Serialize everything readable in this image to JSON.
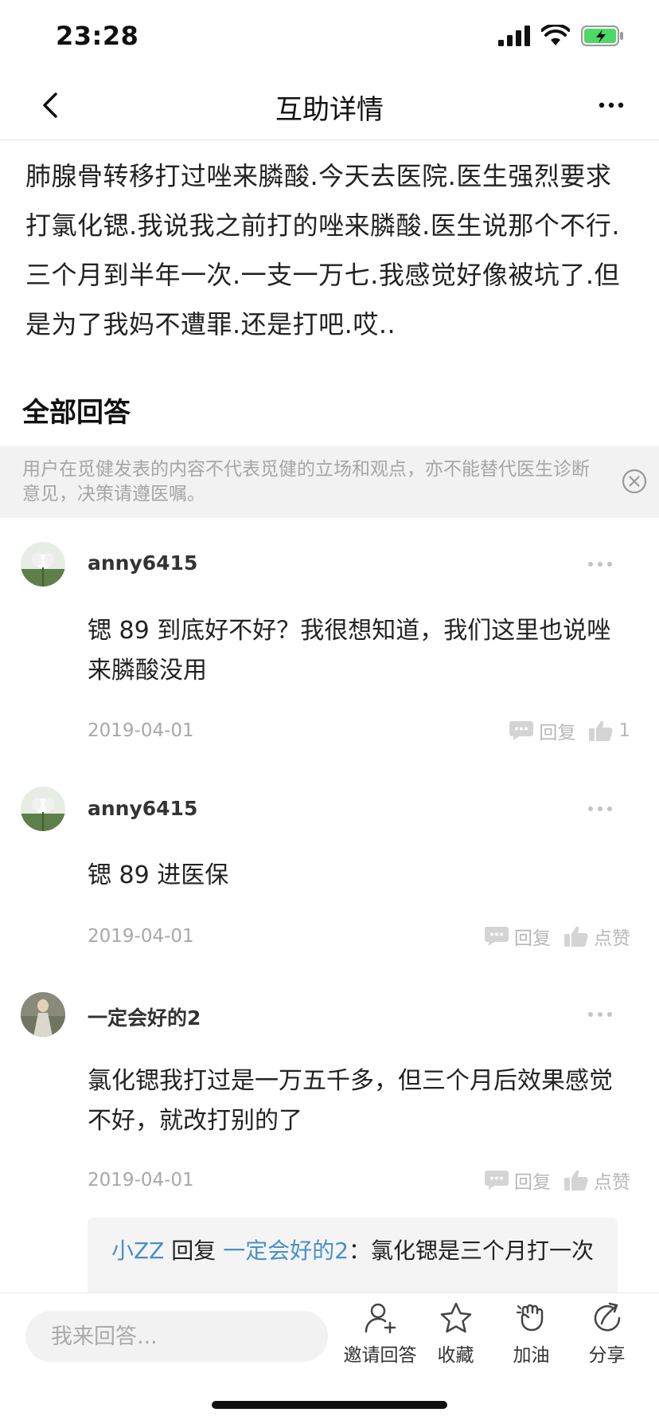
{
  "status_bar": {
    "time": "23:28"
  },
  "nav": {
    "title": "互助详情"
  },
  "question": {
    "text": "肺腺骨转移打过唑来膦酸.今天去医院.医生强烈要求打氯化锶.我说我之前打的唑来膦酸.医生说那个不行.三个月到半年一次.一支一万七.我感觉好像被坑了.但是为了我妈不遭罪.还是打吧.哎.."
  },
  "answers_section": {
    "title": "全部回答"
  },
  "disclaimer": {
    "text": "用户在觅健发表的内容不代表觅健的立场和观点，亦不能替代医生诊断意见，决策请遵医嘱。"
  },
  "answers": [
    {
      "username": "anny6415",
      "text": "锶 89 到底好不好？我很想知道，我们这里也说唑来膦酸没用",
      "date": "2019-04-01",
      "reply_label": "回复",
      "like_label": "1"
    },
    {
      "username": "anny6415",
      "text": "锶 89 进医保",
      "date": "2019-04-01",
      "reply_label": "回复",
      "like_label": "点赞"
    },
    {
      "username": "一定会好的2",
      "text": "氯化锶我打过是一万五千多，但三个月后效果感觉不好，就改打别的了",
      "date": "2019-04-01",
      "reply_label": "回复",
      "like_label": "点赞"
    }
  ],
  "reply": {
    "from_user": "小ZZ",
    "connector": " 回复 ",
    "to_user": "一定会好的2",
    "separator": "：",
    "text": "氯化锶是三个月打一次"
  },
  "bottom_bar": {
    "input_placeholder": "我来回答...",
    "actions": [
      {
        "label": "邀请回答",
        "icon": "invite-user-icon"
      },
      {
        "label": "收藏",
        "icon": "star-icon"
      },
      {
        "label": "加油",
        "icon": "fist-icon"
      },
      {
        "label": "分享",
        "icon": "share-icon"
      }
    ]
  },
  "colors": {
    "link_blue": "#4a90c8",
    "muted_gray": "#a8a8a8",
    "disclaimer_bg": "#f2f2f2"
  }
}
